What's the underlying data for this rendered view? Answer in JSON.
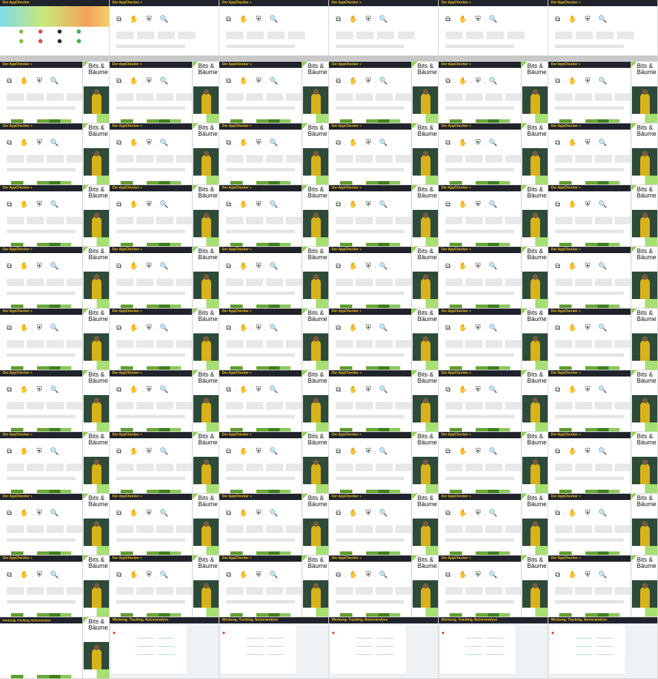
{
  "tiles": {
    "first_title": "Der AppChecker",
    "appchecker_title": "Der AppChecker »",
    "conference_name": "Bits & Bäume",
    "web_title": "Werbung, Tracking, Nutzeranalyse"
  },
  "layout": {
    "columns": 6,
    "rows": 11
  },
  "colors": {
    "header_bg": "#20232b",
    "title_yellow": "#f3c21b",
    "bits_green": "#8fd14f",
    "light_green": "#a7e072",
    "dark_green_bar": "#5f9e2f"
  },
  "icons": [
    "copy-icon",
    "hand-icon",
    "shield-icon",
    "magnifier-icon"
  ]
}
